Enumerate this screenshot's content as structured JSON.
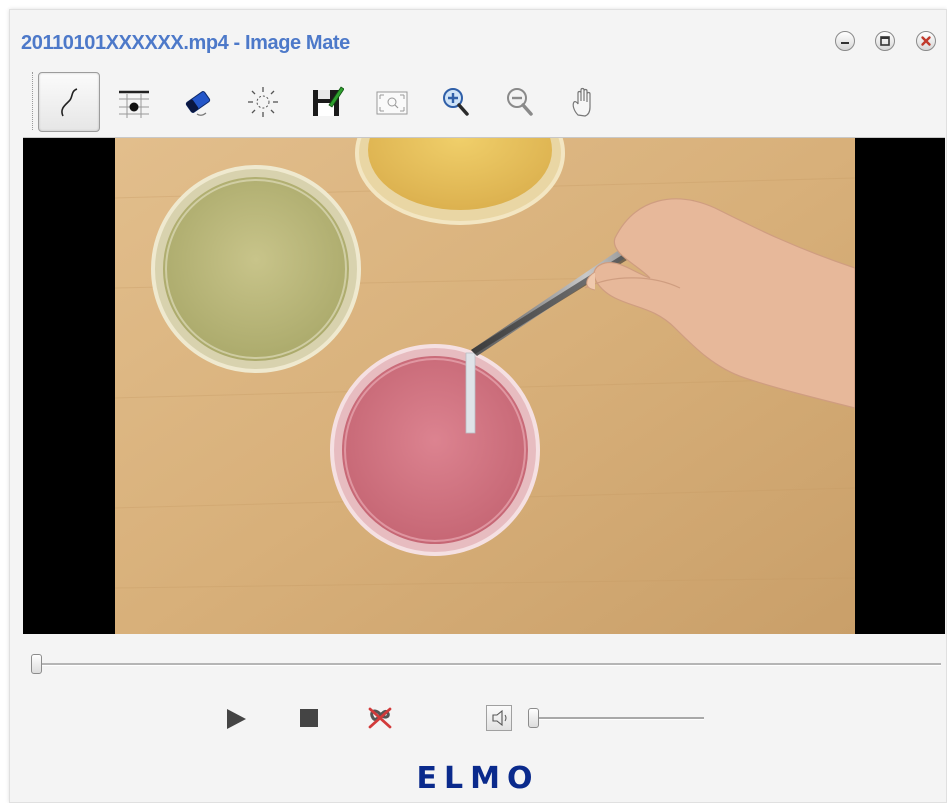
{
  "window": {
    "title": "20110101XXXXXX.mp4 - Image Mate",
    "buttons": [
      "minimize-icon",
      "maximize-icon",
      "close-icon"
    ]
  },
  "toolbar": {
    "tools": [
      {
        "icon": "pen-curve-icon",
        "active": true
      },
      {
        "icon": "grid-pointer-icon",
        "active": false
      },
      {
        "icon": "eraser-icon",
        "active": false
      },
      {
        "icon": "brightness-icon",
        "active": false
      },
      {
        "icon": "save-edit-icon",
        "active": false
      },
      {
        "icon": "fit-screen-icon",
        "active": false
      },
      {
        "icon": "zoom-in-icon",
        "active": false
      },
      {
        "icon": "zoom-out-icon",
        "active": false
      },
      {
        "icon": "hand-pan-icon",
        "active": false
      }
    ]
  },
  "playback": {
    "position": 0,
    "volume": 0,
    "controls": [
      "play-icon",
      "stop-icon",
      "loop-off-icon",
      "speaker-icon"
    ]
  },
  "brand": {
    "logo_text": "ELMO",
    "color": "#0a2a8c"
  },
  "colors": {
    "title": "#4d79c9",
    "close": "#c0392b"
  }
}
